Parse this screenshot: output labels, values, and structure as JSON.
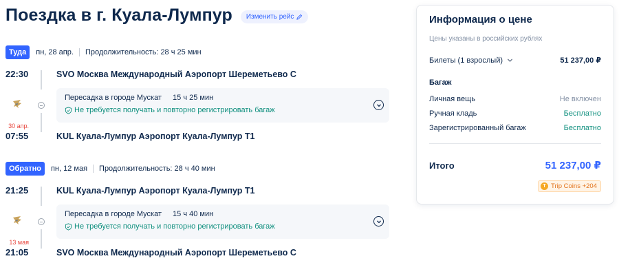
{
  "page": {
    "title": "Поездка в г. Куала-Лумпур",
    "change_label": "Изменить рейс"
  },
  "legs": [
    {
      "direction": "Туда",
      "date": "пн, 28 апр.",
      "duration": "Продолжительность: 28 ч 25 мин",
      "dep_time": "22:30",
      "dep_place": "SVO Москва Международный Аэропорт Шереметьево C",
      "transfer_city": "Пересадка в городе Мускат",
      "transfer_time": "15 ч 25 мин",
      "baggage_note": "Не требуется получать и повторно регистрировать багаж",
      "arr_day": "30 апр.",
      "arr_time": "07:55",
      "arr_place": "KUL Куала-Лумпур Аэропорт Куала-Лумпур T1"
    },
    {
      "direction": "Обратно",
      "date": "пн, 12 мая",
      "duration": "Продолжительность: 28 ч 40 мин",
      "dep_time": "21:25",
      "dep_place": "KUL Куала-Лумпур Аэропорт Куала-Лумпур T1",
      "transfer_city": "Пересадка в городе Мускат",
      "transfer_time": "15 ч 40 мин",
      "baggage_note": "Не требуется получать и повторно регистрировать багаж",
      "arr_day": "13 мая",
      "arr_time": "21:05",
      "arr_place": "SVO Москва Международный Аэропорт Шереметьево C"
    }
  ],
  "price": {
    "title": "Информация о цене",
    "note": "Цены указаны в российских рублях",
    "tickets_label": "Билеты (1 взрослый)",
    "tickets_value": "51 237,00 ₽",
    "baggage_title": "Багаж",
    "baggage": [
      {
        "label": "Личная вещь",
        "value": "Не включен"
      },
      {
        "label": "Ручная кладь",
        "value": "Бесплатно"
      },
      {
        "label": "Зарегистрированный багаж",
        "value": "Бесплатно"
      }
    ],
    "total_label": "Итого",
    "total_value": "51 237,00 ₽",
    "coins_label": "Trip Coins +204",
    "coin_symbol": "T"
  },
  "colors": {
    "accent": "#3264ff",
    "text": "#0f294d",
    "green": "#0f8f7e",
    "red": "#e8463d"
  },
  "icons": [
    "edit-icon",
    "chevron-down-icon",
    "shield-check-icon",
    "expand-chevron-icon",
    "airline-logo-icon",
    "coin-icon"
  ]
}
